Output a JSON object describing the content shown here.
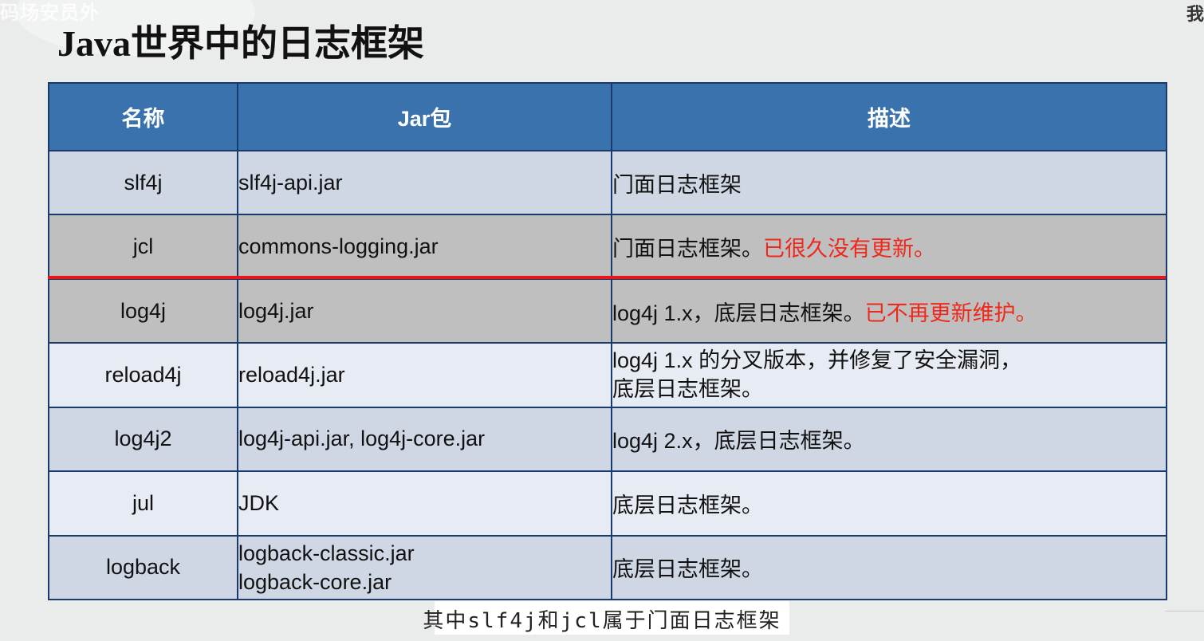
{
  "watermark": "码场安员外",
  "corner_text": "我",
  "title": "Java世界中的日志框架",
  "table": {
    "headers": [
      "名称",
      "Jar包",
      "描述"
    ],
    "rows": [
      {
        "name": "slf4j",
        "jar": "slf4j-api.jar",
        "desc": "门面日志框架",
        "desc_red": ""
      },
      {
        "name": "jcl",
        "jar": "commons-logging.jar",
        "desc": "门面日志框架。",
        "desc_red": "已很久没有更新。"
      },
      {
        "name": "log4j",
        "jar": "log4j.jar",
        "desc": "log4j 1.x，底层日志框架。",
        "desc_red": "已不再更新维护。"
      },
      {
        "name": "reload4j",
        "jar": "reload4j.jar",
        "desc": "log4j 1.x 的分叉版本，并修复了安全漏洞，",
        "desc2": "底层日志框架。"
      },
      {
        "name": "log4j2",
        "jar": "log4j-api.jar, log4j-core.jar",
        "desc": "log4j 2.x，底层日志框架。"
      },
      {
        "name": "jul",
        "jar": "JDK",
        "desc": "底层日志框架。"
      },
      {
        "name": "logback",
        "jar": "logback-classic.jar",
        "jar2": "logback-core.jar",
        "desc": "底层日志框架。"
      }
    ]
  },
  "subtitle": "其中slf4j和jcl属于门面日志框架",
  "colors": {
    "header_bg": "#3a72ad",
    "highlight_red": "#f0281c",
    "divider_red": "#e8161b",
    "gray_row": "#bfbfbf"
  }
}
